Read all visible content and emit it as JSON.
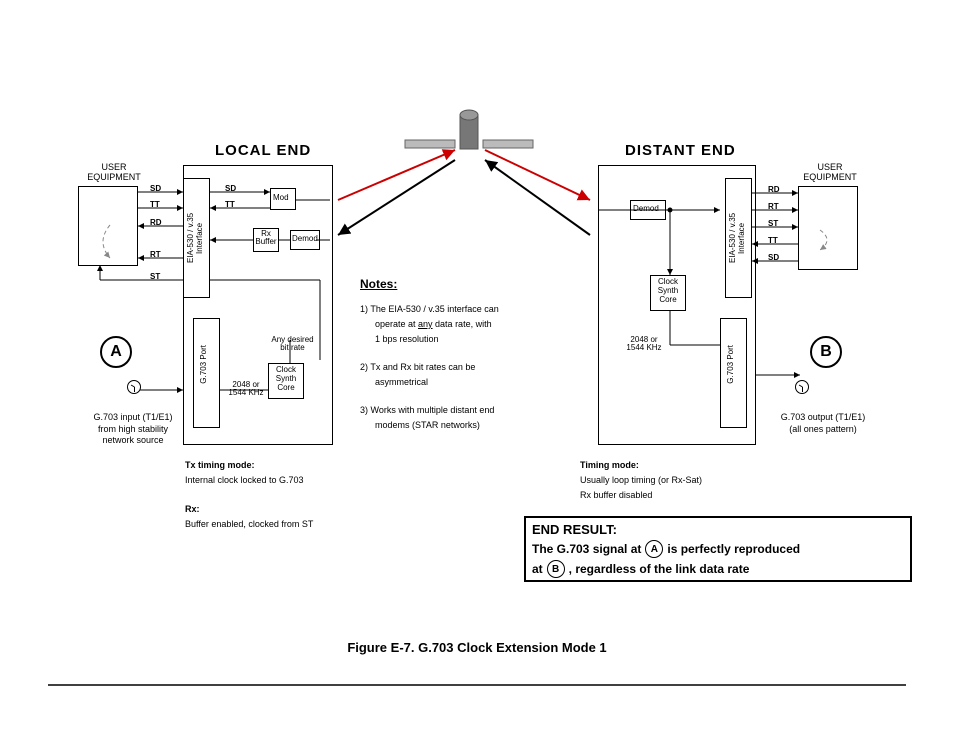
{
  "figure": {
    "caption": "Figure E-7. G.703 Clock Extension Mode 1"
  },
  "local": {
    "title": "LOCAL END",
    "user_eq": "USER\nEQUIPMENT",
    "signals": {
      "sd": "SD",
      "tt": "TT",
      "rd": "RD",
      "rt": "RT",
      "st": "ST"
    },
    "iface": "EIA-530 / v.35\nInterface",
    "mod": "Mod",
    "rxbuf": "Rx\nBuffer",
    "demod": "Demod",
    "g703port": "G.703 Port",
    "clkrate": "2048 or\n1544 KHz",
    "csc": "Clock\nSynth\nCore",
    "anyrate": "Any desired\nbit rate",
    "marker": "A",
    "input_label": "G.703 input (T1/E1)\nfrom high stability\nnetwork source",
    "txmode_h": "Tx timing mode:",
    "txmode_b": "Internal clock locked to G.703",
    "rx_h": "Rx:",
    "rx_b": "Buffer enabled, clocked from ST"
  },
  "notes": {
    "heading": "Notes:",
    "n1a": "1) The EIA-530 / v.35 interface can",
    "n1b": "operate at ",
    "n1b_u": "any",
    "n1c": " data rate, with",
    "n1d": "1 bps resolution",
    "n2a": "2) Tx and Rx bit rates can be",
    "n2b": "asymmetrical",
    "n3a": "3) Works with multiple distant end",
    "n3b": "modems (STAR networks)"
  },
  "distant": {
    "title": "DISTANT END",
    "user_eq": "USER\nEQUIPMENT",
    "signals": {
      "rd": "RD",
      "rt": "RT",
      "st": "ST",
      "tt": "TT",
      "sd": "SD"
    },
    "iface": "EIA-530 / v.35\nInterface",
    "demod": "Demod",
    "csc": "Clock\nSynth\nCore",
    "g703port": "G.703 Port",
    "clkrate": "2048 or\n1544 KHz",
    "marker": "B",
    "output_label": "G.703 output (T1/E1)\n(all ones pattern)",
    "tmode_h": "Timing mode:",
    "tmode_b1": "Usually loop timing (or Rx-Sat)",
    "tmode_b2": "Rx buffer disabled"
  },
  "endresult": {
    "h": "END RESULT:",
    "p1": "The G.703 signal at ",
    "a": "A",
    "p2": " is perfectly reproduced",
    "p3": "at ",
    "b": "B",
    "p4": " , regardless of the link data rate"
  }
}
